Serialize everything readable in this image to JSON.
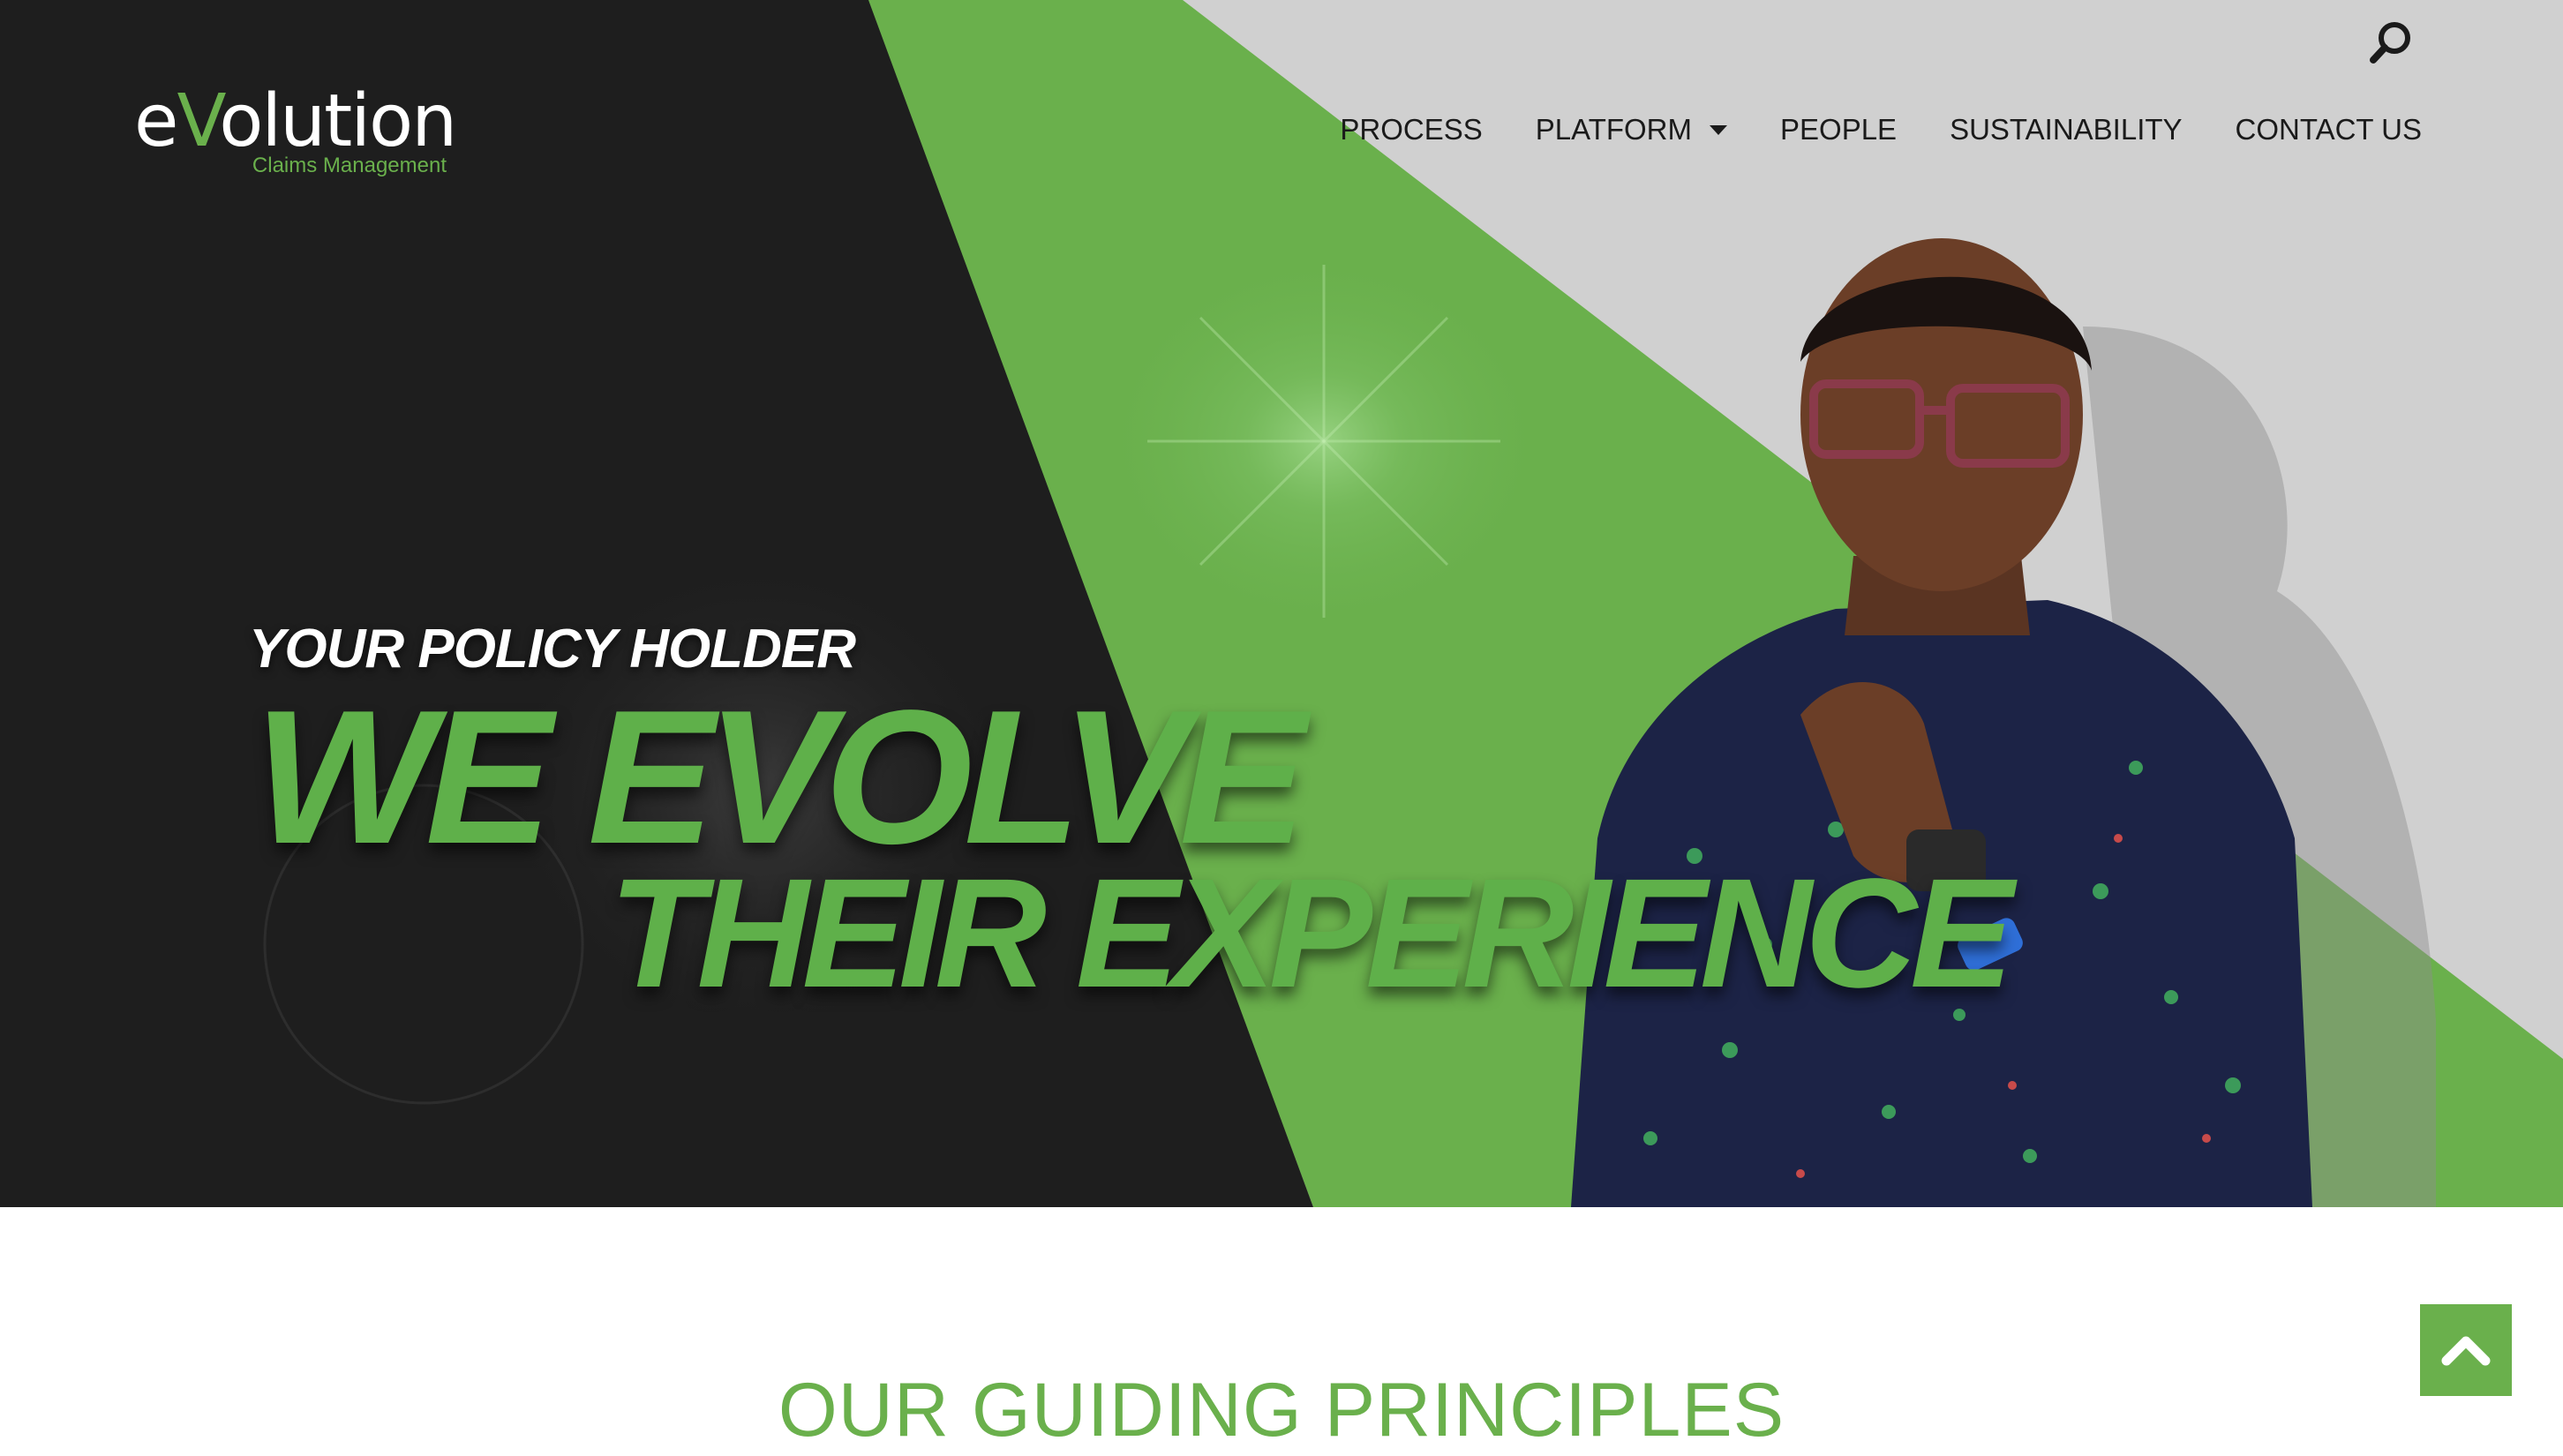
{
  "header": {
    "logo_word_prefix": "e",
    "logo_word_v": "V",
    "logo_word_suffix": "olution",
    "logo_tagline": "Claims Management",
    "search_icon": "search-icon"
  },
  "nav": {
    "items": [
      {
        "label": "PROCESS",
        "has_dropdown": false
      },
      {
        "label": "PLATFORM",
        "has_dropdown": true
      },
      {
        "label": "PEOPLE",
        "has_dropdown": false
      },
      {
        "label": "SUSTAINABILITY",
        "has_dropdown": false
      },
      {
        "label": "CONTACT US",
        "has_dropdown": false
      }
    ]
  },
  "hero": {
    "kicker": "YOUR POLICY HOLDER",
    "line1": "WE EVOLVE",
    "line2": "THEIR EXPERIENCE"
  },
  "main": {
    "section_title": "OUR GUIDING PRINCIPLES"
  },
  "back_to_top_icon": "chevron-up-icon",
  "colors": {
    "brand_green": "#6ab04c",
    "hero_dark": "#1e1e1e",
    "hero_light": "#d0d0d0",
    "nav_text": "#1a1a1a"
  }
}
